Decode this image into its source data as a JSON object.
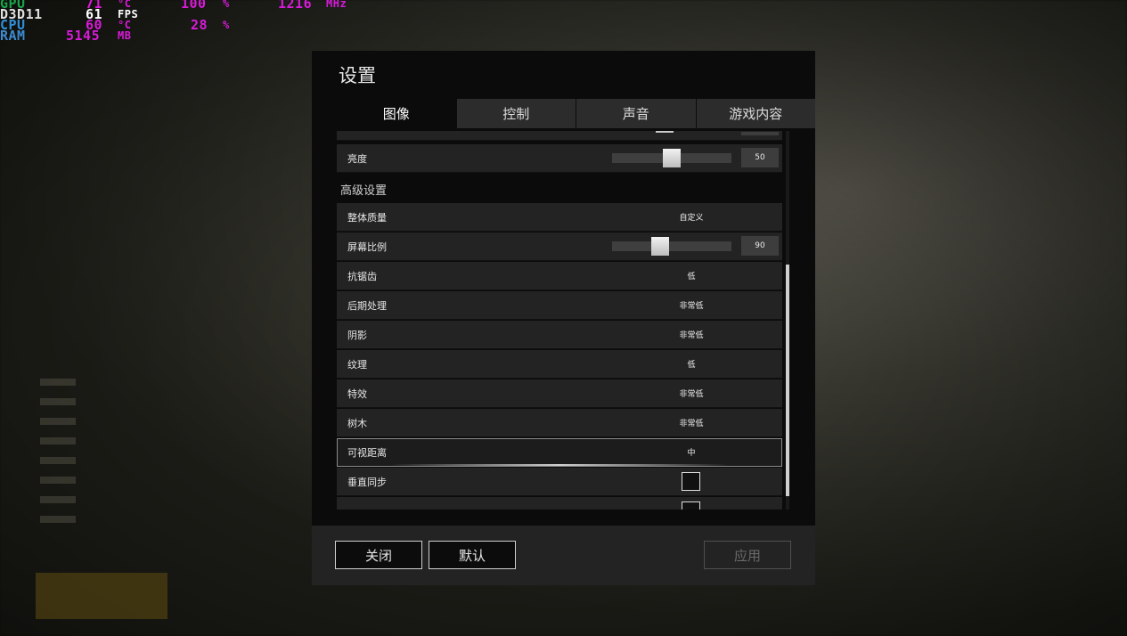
{
  "osd": {
    "gpu": {
      "label": "GPU",
      "temp": "71",
      "temp_unit": "°C",
      "load": "100",
      "load_unit": "%",
      "clock": "1216",
      "clock_unit": "MHz"
    },
    "api": {
      "label": "D3D11",
      "fps": "61",
      "fps_unit": "FPS"
    },
    "cpu": {
      "label": "CPU",
      "temp": "60",
      "temp_unit": "°C",
      "load": "28",
      "load_unit": "%"
    },
    "ram": {
      "label": "RAM",
      "value": "5145",
      "unit": "MB"
    },
    "colors": {
      "gpu": "#1aa34a",
      "d3d": "#e0e0e0",
      "cpu": "#2f8fd6",
      "ram": "#3c8bd0",
      "value": "#d81bd8",
      "fps": "#ffffff"
    }
  },
  "dialog": {
    "title": "设置",
    "tabs": [
      "图像",
      "控制",
      "声音",
      "游戏内容"
    ],
    "active_tab": "图像"
  },
  "settings": {
    "brightness": {
      "label": "亮度",
      "value": "50"
    },
    "advanced_header": "高级设置",
    "overall_quality": {
      "label": "整体质量",
      "value": "自定义"
    },
    "screen_scale": {
      "label": "屏幕比例",
      "value": "90"
    },
    "antialiasing": {
      "label": "抗锯齿",
      "value": "低"
    },
    "post_processing": {
      "label": "后期处理",
      "value": "非常低"
    },
    "shadows": {
      "label": "阴影",
      "value": "非常低"
    },
    "textures": {
      "label": "纹理",
      "value": "低"
    },
    "effects": {
      "label": "特效",
      "value": "非常低"
    },
    "foliage": {
      "label": "树木",
      "value": "非常低"
    },
    "view_distance": {
      "label": "可视距离",
      "value": "中"
    },
    "vsync": {
      "label": "垂直同步",
      "checked": false
    }
  },
  "footer": {
    "close": "关闭",
    "default": "默认",
    "apply": "应用"
  }
}
